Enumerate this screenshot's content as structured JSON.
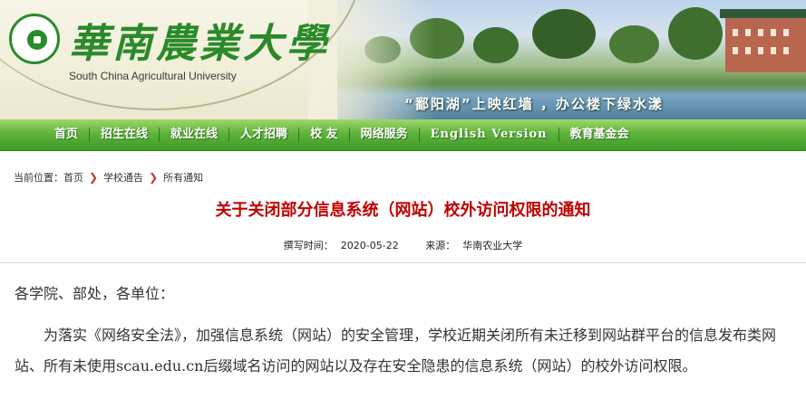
{
  "header": {
    "school_cn": "華南農業大學",
    "school_en": "South China Agricultural University",
    "slogan": "“鄱阳湖”上映红墙 ，办公楼下绿水漾"
  },
  "nav": {
    "items": [
      "首页",
      "招生在线",
      "就业在线",
      "人才招聘",
      "校 友",
      "网络服务",
      "English Version",
      "教育基金会"
    ]
  },
  "breadcrumb": {
    "prefix": "当前位置：",
    "items": [
      "首页",
      "学校通告",
      "所有通知"
    ]
  },
  "article": {
    "title": "关于关闭部分信息系统（网站）校外访问权限的通知",
    "date_label": "撰写时间：",
    "date": "2020-05-22",
    "source_label": "来源：",
    "source": "华南农业大学",
    "salutation": "各学院、部处，各单位：",
    "paragraph": "为落实《网络安全法》，加强信息系统（网站）的安全管理，学校近期关闭所有未迁移到网站群平台的信息发布类网站、所有未使用scau.edu.cn后缀域名访问的网站以及存在安全隐患的信息系统（网站）的校外访问权限。"
  },
  "colors": {
    "brand_green": "#2a8a2a",
    "nav_green": "#5fb43a",
    "title_red": "#c00000"
  }
}
